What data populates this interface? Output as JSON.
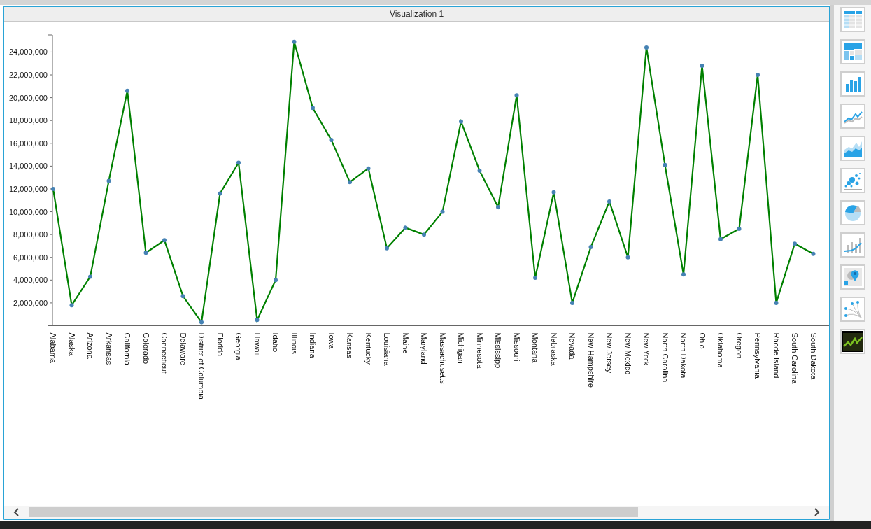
{
  "panel": {
    "title": "Visualization 1",
    "chart_data": {
      "type": "line",
      "categories": [
        "Alabama",
        "Alaska",
        "Arizona",
        "Arkansas",
        "California",
        "Colorado",
        "Connecticut",
        "Delaware",
        "District of Columbia",
        "Florida",
        "Georgia",
        "Hawaii",
        "Idaho",
        "Illinois",
        "Indiana",
        "Iowa",
        "Kansas",
        "Kentucky",
        "Louisiana",
        "Maine",
        "Maryland",
        "Massachusetts",
        "Michigan",
        "Minnesota",
        "Mississippi",
        "Missouri",
        "Montana",
        "Nebraska",
        "Nevada",
        "New Hampshire",
        "New Jersey",
        "New Mexico",
        "New York",
        "North Carolina",
        "North Dakota",
        "Ohio",
        "Oklahoma",
        "Oregon",
        "Pennsylvania",
        "Rhode Island",
        "South Carolina",
        "South Dakota"
      ],
      "series": [
        {
          "color": "#008000",
          "marker": "circle",
          "values": [
            12000000,
            1800000,
            4300000,
            12700000,
            20600000,
            6400000,
            7500000,
            2600000,
            300000,
            11600000,
            14300000,
            500000,
            4000000,
            24900000,
            19100000,
            16300000,
            12600000,
            13800000,
            6800000,
            8600000,
            8000000,
            10000000,
            17900000,
            13600000,
            10400000,
            20200000,
            4200000,
            11700000,
            2000000,
            6900000,
            10900000,
            6000000,
            24400000,
            14100000,
            4500000,
            22800000,
            7600000,
            8500000,
            22000000,
            2000000,
            7200000,
            6300000
          ]
        }
      ],
      "ylim": [
        0,
        25500000
      ],
      "yticks": [
        {
          "value": 2000000,
          "label": "2,000,000"
        },
        {
          "value": 4000000,
          "label": "4,000,000"
        },
        {
          "value": 6000000,
          "label": "6,000,000"
        },
        {
          "value": 8000000,
          "label": "8,000,000"
        },
        {
          "value": 10000000,
          "label": "10,000,000"
        },
        {
          "value": 12000000,
          "label": "12,000,000"
        },
        {
          "value": 14000000,
          "label": "14,000,000"
        },
        {
          "value": 16000000,
          "label": "16,000,000"
        },
        {
          "value": 18000000,
          "label": "18,000,000"
        },
        {
          "value": 20000000,
          "label": "20,000,000"
        },
        {
          "value": 22000000,
          "label": "22,000,000"
        },
        {
          "value": 24000000,
          "label": "24,000,000"
        }
      ]
    }
  }
}
